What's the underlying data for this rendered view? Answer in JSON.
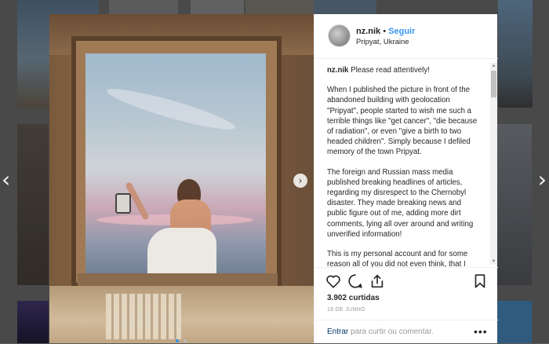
{
  "post": {
    "username": "nz.nik",
    "separator": "•",
    "follow_label": "Seguir",
    "location": "Pripyat, Ukraine",
    "caption_user": "nz.nik",
    "caption_lead": "Please read attentively!",
    "caption_p1": "When I published the picture in front of the abandoned building with geolocation \"Pripyat\", people started to wish me such a terrible things like \"get cancer\", \"die because of radiation\", or even \"give a birth to two headed children\". Simply because I defiled memory of the town Pripyat.",
    "caption_p2": "The foreign and Russian mass media published breaking headlines of articles, regarding my disrespect to the Chernobyl disaster. They made breaking news and public figure out of me, adding more dirt comments, lying all over around and writing unverified information!",
    "caption_p3": "This is my personal account and for some reason all of you did not even think, that I",
    "likes": "3.902 curtidas",
    "date": "16 DE JUNHO",
    "login_link": "Entrar",
    "login_rest": "para curtir ou comentar.",
    "more": "•••"
  },
  "nav": {
    "prev": "‹",
    "next": "›",
    "photo_next": "›"
  },
  "carousel": {
    "count": 2,
    "active_index": 0
  },
  "icons": {
    "like": "heart-icon",
    "comment": "comment-icon",
    "share": "share-icon",
    "save": "bookmark-icon"
  },
  "colors": {
    "link": "#3897f0",
    "text": "#262626",
    "muted": "#999999"
  }
}
